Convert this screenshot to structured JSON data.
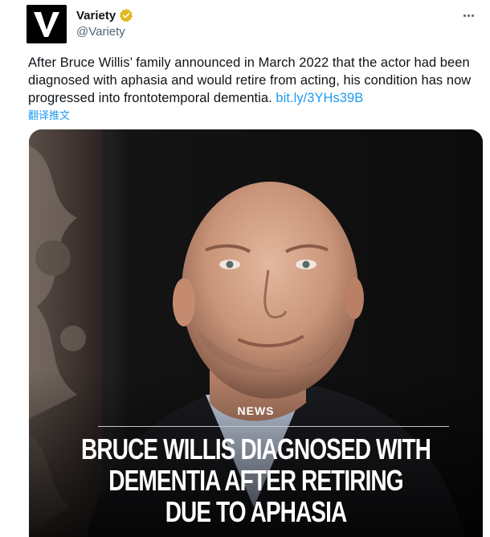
{
  "author": {
    "display_name": "Variety",
    "handle": "@Variety",
    "verified": true,
    "verified_color": "#e2b719",
    "avatar_icon": "variety-v-logo-icon"
  },
  "tweet": {
    "text": "After Bruce Willis’ family announced in March 2022 that the actor had been diagnosed with aphasia and would retire from acting, his condition has now progressed into frontotemporal dementia. ",
    "link_text": "bit.ly/3YHs39B",
    "translate_label": "翻译推文",
    "link_color": "#1d9bf0"
  },
  "media": {
    "section_label": "NEWS",
    "headline_lines": [
      "BRUCE WILLIS DIAGNOSED WITH",
      "DEMENTIA AFTER RETIRING",
      "DUE TO APHASIA"
    ]
  },
  "menu": {
    "more_icon": "more-options-icon"
  }
}
